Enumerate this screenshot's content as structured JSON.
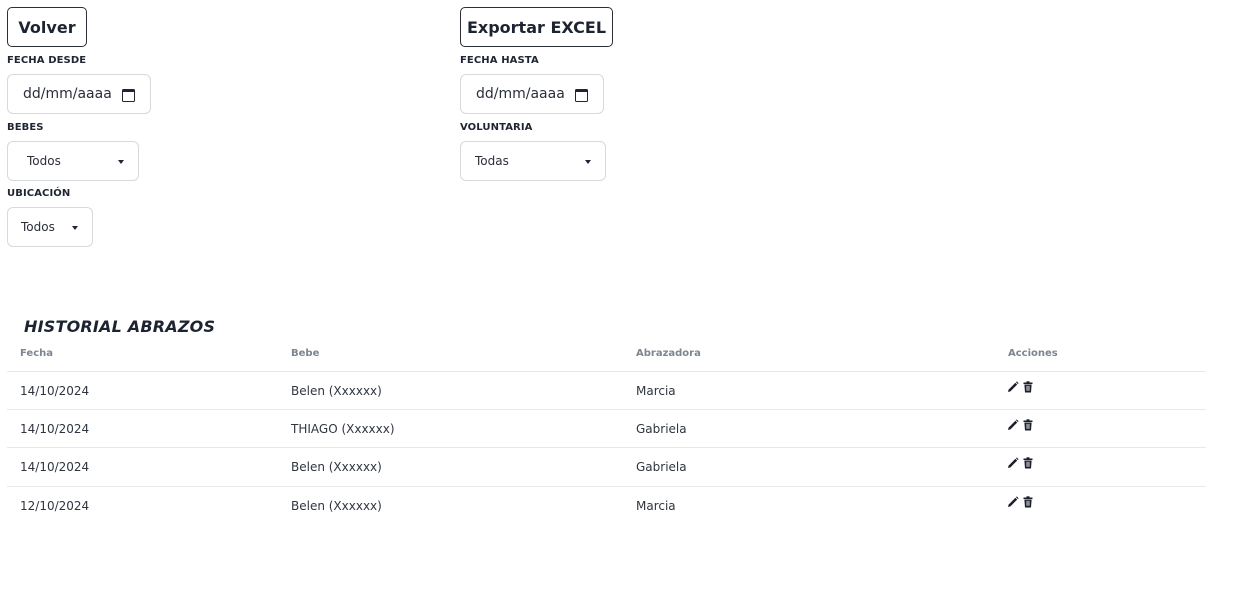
{
  "toolbar": {
    "back_label": "Volver",
    "export_label": "Exportar EXCEL"
  },
  "filters": {
    "fecha_desde": {
      "label": "FECHA DESDE",
      "placeholder": "dd/mm/aaaa"
    },
    "fecha_hasta": {
      "label": "FECHA HASTA",
      "placeholder": "dd/mm/aaaa"
    },
    "bebes": {
      "label": "BEBES",
      "selected": "Todos"
    },
    "voluntaria": {
      "label": "VOLUNTARIA",
      "selected": "Todas"
    },
    "ubicacion": {
      "label": "UBICACIÓN",
      "selected": "Todos"
    }
  },
  "table": {
    "title": "HISTORIAL ABRAZOS",
    "columns": [
      "Fecha",
      "Bebe",
      "Abrazadora",
      "Acciones"
    ],
    "rows": [
      {
        "fecha": "14/10/2024",
        "bebe": "Belen (Xxxxxx)",
        "abrazadora": "Marcia",
        "actions": [
          "edit-icon",
          "trash-icon"
        ]
      },
      {
        "fecha": "14/10/2024",
        "bebe": "THIAGO (Xxxxxx)",
        "abrazadora": "Gabriela",
        "actions": [
          "edit-icon",
          "trash-icon"
        ]
      },
      {
        "fecha": "14/10/2024",
        "bebe": "Belen (Xxxxxx)",
        "abrazadora": "Gabriela",
        "actions": [
          "edit-icon",
          "trash-icon"
        ]
      },
      {
        "fecha": "12/10/2024",
        "bebe": "Belen (Xxxxxx)",
        "abrazadora": "Marcia",
        "actions": [
          "edit-icon",
          "trash-icon"
        ]
      }
    ]
  }
}
